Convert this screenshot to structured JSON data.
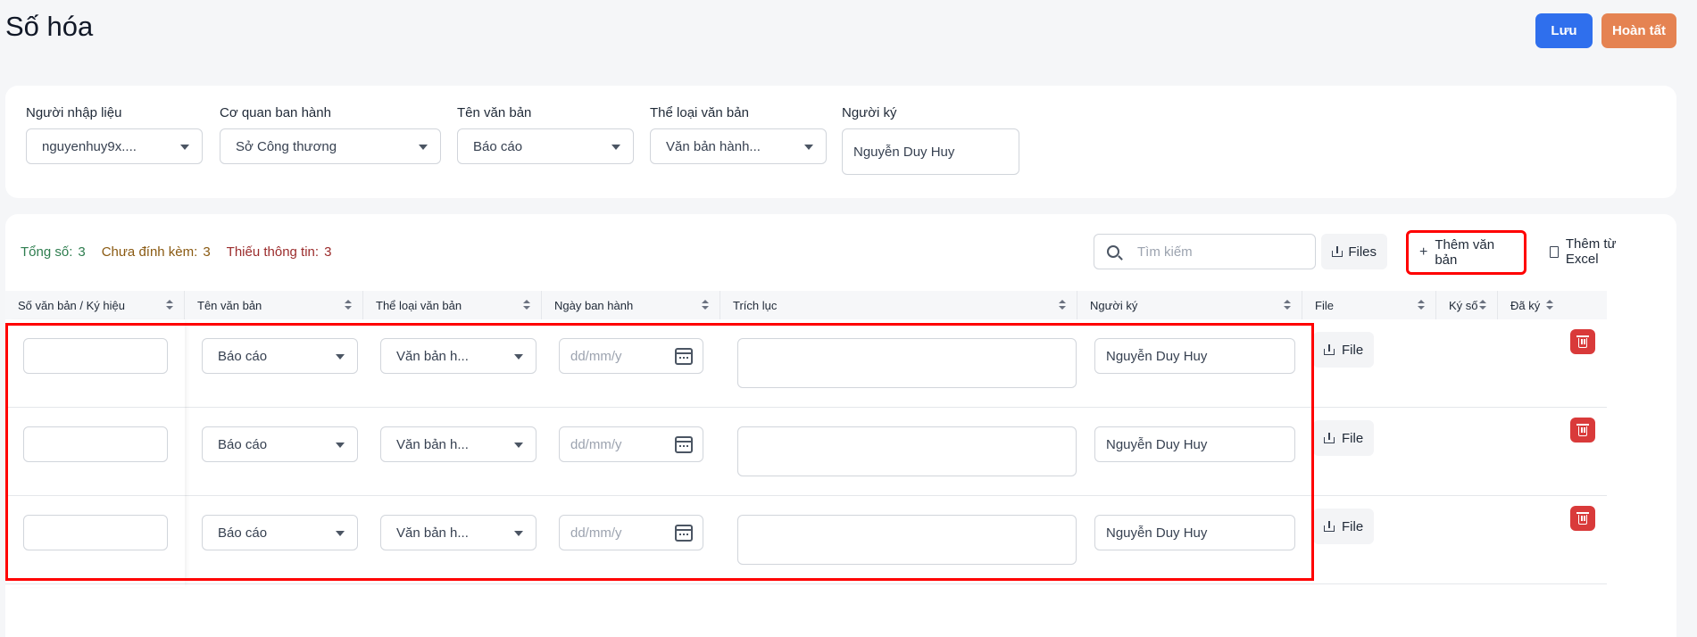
{
  "page": {
    "title": "Số hóa",
    "save_label": "Lưu",
    "complete_label": "Hoàn tất"
  },
  "filters": {
    "entry_user": {
      "label": "Người nhập liệu",
      "value": "nguyenhuy9x...."
    },
    "issuing_agency": {
      "label": "Cơ quan ban hành",
      "value": "Sở Công thương"
    },
    "doc_name": {
      "label": "Tên văn bản",
      "value": "Báo cáo"
    },
    "doc_type": {
      "label": "Thể loại văn bản",
      "value": "Văn bản hành..."
    },
    "signer": {
      "label": "Người ký",
      "value": "Nguyễn Duy Huy"
    }
  },
  "stats": {
    "total_label": "Tổng số:",
    "total": "3",
    "unattached_label": "Chưa đính kèm:",
    "unattached": "3",
    "missing_label": "Thiếu thông tin:",
    "missing": "3"
  },
  "toolbar": {
    "search_placeholder": "Tìm kiếm",
    "files_label": "Files",
    "add_doc_label": "Thêm văn bản",
    "excel_label": "Thêm từ Excel"
  },
  "table": {
    "columns": [
      "Số văn bản / Ký hiệu",
      "Tên văn bản",
      "Thể loại văn bản",
      "Ngày ban hành",
      "Trích lục",
      "Người ký",
      "File",
      "Ký số",
      "Đã ký"
    ],
    "rows": [
      {
        "number": "",
        "name": "Báo cáo",
        "type": "Văn bản h...",
        "date_placeholder": "dd/mm/y",
        "excerpt": "",
        "signer": "Nguyễn Duy Huy",
        "file_label": "File"
      },
      {
        "number": "",
        "name": "Báo cáo",
        "type": "Văn bản h...",
        "date_placeholder": "dd/mm/y",
        "excerpt": "",
        "signer": "Nguyễn Duy Huy",
        "file_label": "File"
      },
      {
        "number": "",
        "name": "Báo cáo",
        "type": "Văn bản h...",
        "date_placeholder": "dd/mm/y",
        "excerpt": "",
        "signer": "Nguyễn Duy Huy",
        "file_label": "File"
      }
    ]
  },
  "colors": {
    "primary": "#2f6fed",
    "accent": "#e58352",
    "danger": "#d93a3a",
    "highlight": "#ff0000"
  }
}
